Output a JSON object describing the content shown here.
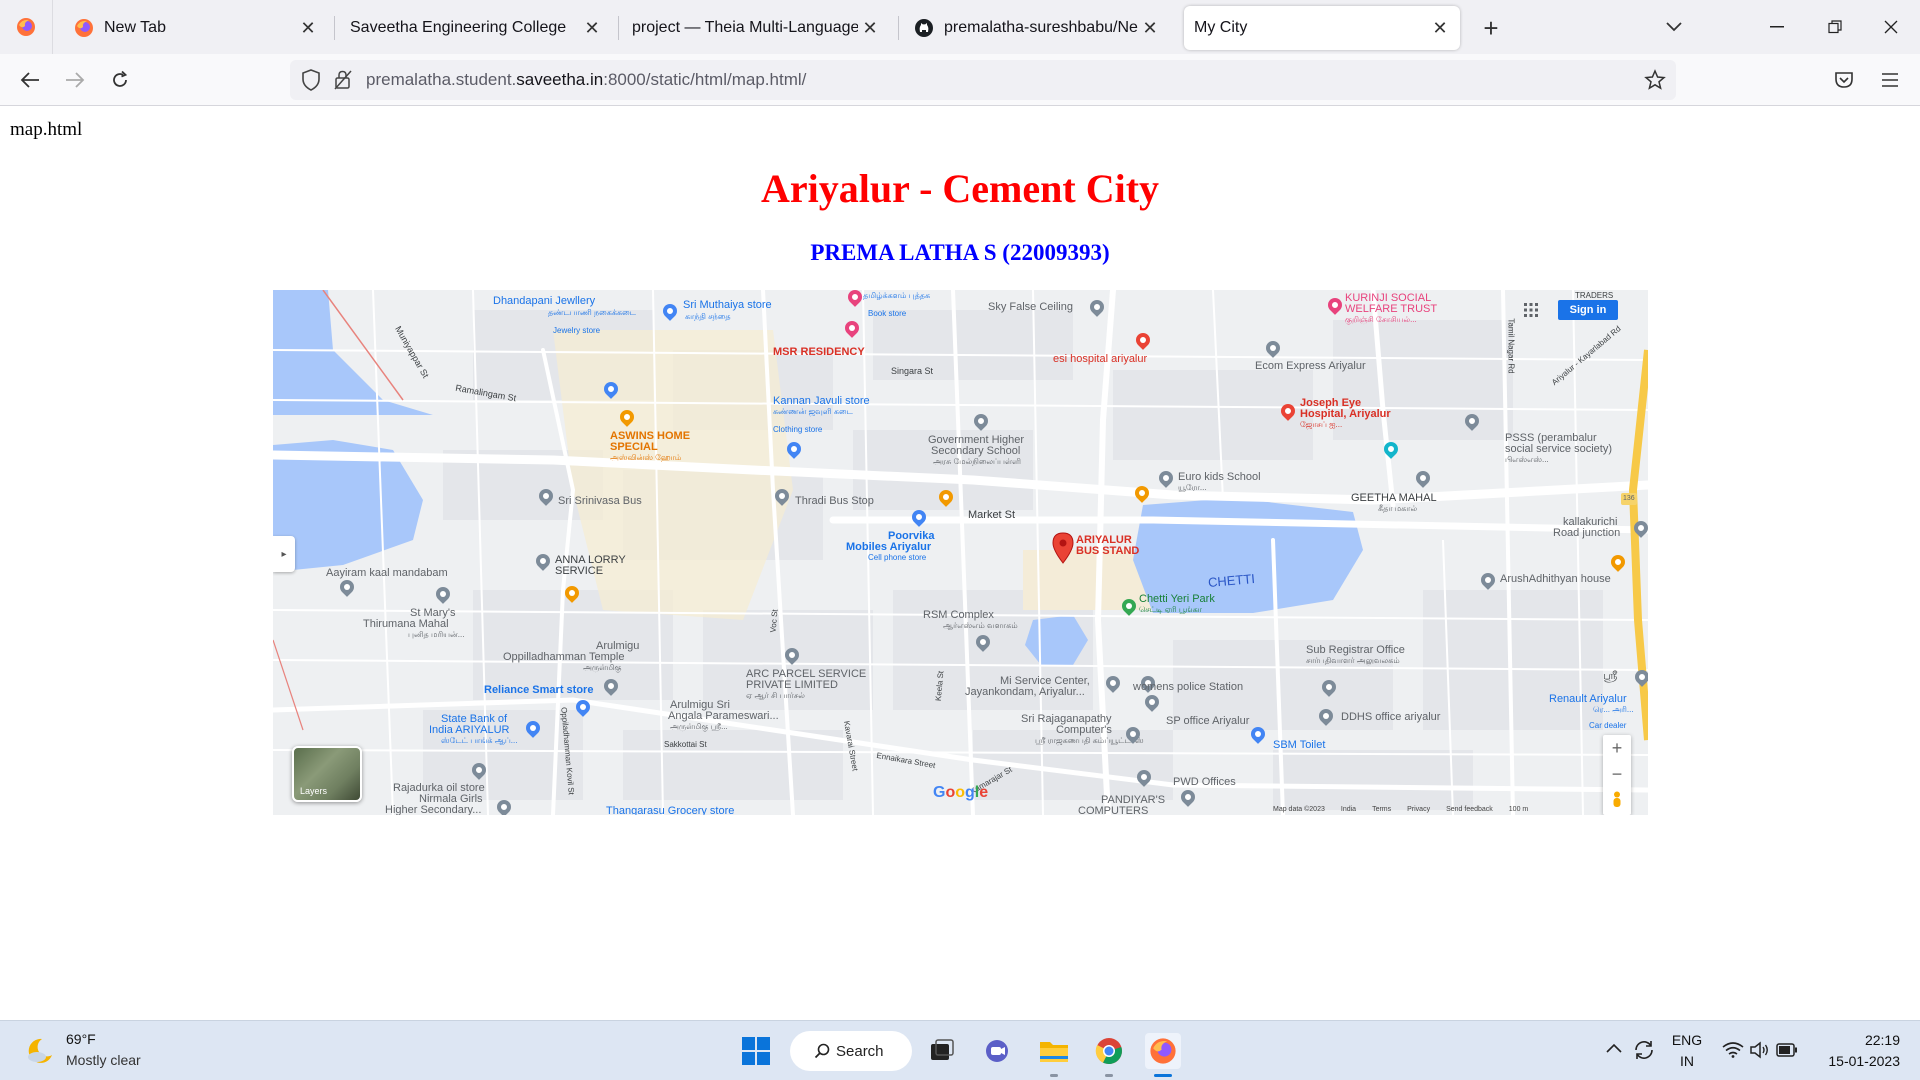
{
  "browser": {
    "tabs": [
      {
        "title": "New Tab",
        "icon": "firefox-icon"
      },
      {
        "title": "Saveetha Engineering College",
        "icon": "page-icon"
      },
      {
        "title": "project — Theia Multi-Language Ex",
        "icon": "page-icon"
      },
      {
        "title": "premalatha-sureshbabu/NearM",
        "icon": "github-icon"
      },
      {
        "title": "My City",
        "icon": "page-icon",
        "active": true
      }
    ],
    "url": {
      "prefix": "premalatha.student.",
      "domain": "saveetha.in",
      "suffix": ":8000/static/html/map.html/"
    }
  },
  "page": {
    "filename": "map.html",
    "title": "Ariyalur - Cement City",
    "subtitle": "PREMA LATHA S (22009393)"
  },
  "map": {
    "labels": {
      "dhandapani": "Dhandapani Jewllery",
      "dhandapani_ta": "தண்டபாணி நகைக்கடை",
      "dhandapani_cat": "Jewelry store",
      "muthaiya": "Sri Muthaiya store",
      "muthaiya_ta": "காந்தி சந்தை",
      "book_ta": "தமிழ்க்களம் புத்தக",
      "book_cat": "Book store",
      "sky_false": "Sky False Ceiling",
      "kurinji1": "KURINJI SOCIAL",
      "kurinji2": "WELFARE TRUST",
      "kurinji_ta": "குறிஞ்சி சோசியல்...",
      "traders": "TRADERS",
      "msr": "MSR RESIDENCY",
      "singara": "Singara St",
      "esi": "esi hospital ariyalur",
      "ecom": "Ecom Express Ariyalur",
      "muniyappar": "Muniyappar St",
      "ramalingam": "Ramalingam St",
      "kannan1": "Kannan Javuli store",
      "kannan_ta": "கண்ணன் ஜவுளி கடை",
      "kannan_cat": "Clothing store",
      "joseph1": "Joseph Eye",
      "joseph2": "Hospital, Ariyalur",
      "joseph_ta": "ஜோசப் ஐ...",
      "ariyalur_rd": "Ariyalur - Kayarlabad Rd",
      "tamil_nagar": "Tamil Nagar Rd",
      "aswins1": "ASWINS HOME",
      "aswins2": "SPECIAL",
      "aswins_ta": "அஸ்வின்ஸ் ஹோம்",
      "govt1": "Government Higher",
      "govt2": "Secondary School",
      "govt_ta": "அரசு மேல்நிலைப்பள்ளி",
      "pssss1": "PSSS (perambalur",
      "pssss2": "social service society)",
      "pssss_ta": "பிஎஸ்எஸ்...",
      "euro": "Euro kids School",
      "euro_ta": "யூரோ...",
      "srinivasa": "Sri Srinivasa Bus",
      "thradi": "Thradi Bus Stop",
      "market": "Market St",
      "geetha": "GEETHA MAHAL",
      "geetha_ta": "கீதா மகால்",
      "kallakurichi1": "kallakurichi",
      "kallakurichi2": "Road junction",
      "poorvika1": "Poorvika",
      "poorvika2": "Mobiles Ariyalur",
      "poorvika_cat": "Cell phone store",
      "busstand1": "ARIYALUR",
      "busstand2": "BUS STAND",
      "anna1": "ANNA LORRY",
      "anna2": "SERVICE",
      "aayiram": "Aayiram kaal mandabam",
      "chetti_lake": "CHETTI",
      "arush": "ArushAdhithyan house",
      "chetti_park": "Chetti Yeri Park",
      "chetti_park_ta": "செட்டி ஏரி பூங்கா",
      "stmary1": "St Mary's",
      "stmary2": "Thirumana Mahal",
      "stmary_ta": "புனித மரியன்...",
      "rsm": "RSM Complex",
      "rsm_ta": "ஆர்எஸ்எம் வளாகம்",
      "arulmigu1": "Arulmigu",
      "arulmigu2": "Oppilladhamman Temple",
      "arulmigu_ta": "அருள்மிகு",
      "voc": "Voc St",
      "arc1": "ARC PARCEL SERVICE",
      "arc2": "PRIVATE LIMITED",
      "arc_ta": "ஏ ஆர் சி பார்சல்",
      "subreg": "Sub Registrar Office",
      "subreg_ta": "சார்பதிவாளர் அலுவலகம்",
      "mi1": "Mi Service Center,",
      "mi2": "Jayankondam, Ariyalur...",
      "womens": "womens police Station",
      "reliance": "Reliance Smart store",
      "angala1": "Arulmigu Sri",
      "angala2": "Angala Parameswari...",
      "angala_ta": "அருள்மிகு ஸ்ரீ...",
      "keela": "Keela St",
      "kavarai": "Kavarai Street",
      "sbi1": "State Bank of",
      "sbi2": "India ARIYALUR",
      "sbi_ta": "ஸ்டேட் பாங்க் ஆப்...",
      "sakkottai": "Sakkottai St",
      "opilla": "Oppiladhamman Kovil St",
      "rajaganapathy1": "Sri Rajaganapathy",
      "rajaganapathy2": "Computer's",
      "rajaganapathy_ta": "ஸ்ரீ ராஜகணபதி கம்ப்யூட்டர்ஸ்",
      "sp_office": "SP office Ariyalur",
      "sbm": "SBM Toilet",
      "ddhs": "DDHS office ariyalur",
      "renault": "Renault Ariyalur",
      "renault_ta": "ரெ... அரி...",
      "renault_cat": "Car dealer",
      "sri_right": "ஸ்ரீ",
      "ennaikara": "Ennaikara Street",
      "rajadurka1": "Rajadurka oil store",
      "nirmala1": "Nirmala Girls",
      "nirmala2": "Higher Secondary...",
      "thangarasu": "Thangarasu Grocery store",
      "pwd": "PWD Offices",
      "pandiyar1": "PANDIYAR'S",
      "pandiyar2": "COMPUTERS",
      "kamarajar": "Kamarajar St",
      "road136": "136"
    },
    "signin": "Sign in",
    "layers": "Layers",
    "footer": [
      "Map data ©2023",
      "India",
      "Terms",
      "Privacy",
      "Send feedback",
      "100 m"
    ],
    "google": "Google"
  },
  "taskbar": {
    "weather_temp": "69°F",
    "weather_desc": "Mostly clear",
    "search": "Search",
    "lang1": "ENG",
    "lang2": "IN",
    "time": "22:19",
    "date": "15-01-2023"
  },
  "colors": {
    "title": "#ff0000",
    "subtitle": "#0000ff",
    "water": "#a8c7fa",
    "accent": "#1a73e8"
  }
}
